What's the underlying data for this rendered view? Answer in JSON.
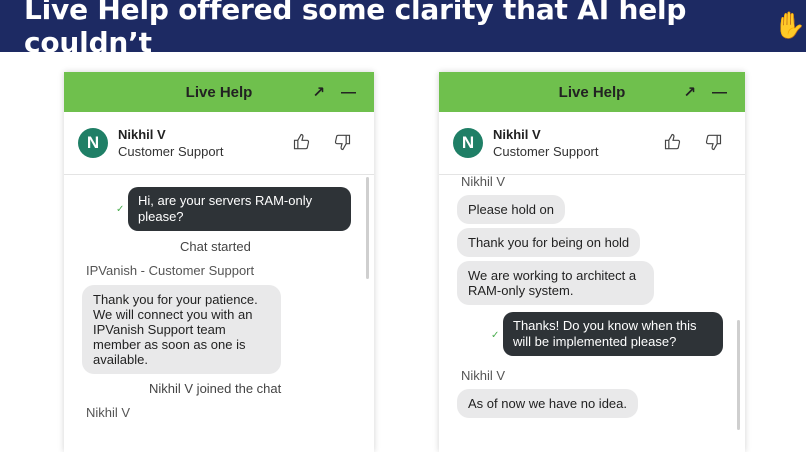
{
  "banner": {
    "title": "Live Help offered some clarity that AI help couldn’t",
    "emoji": "✋"
  },
  "left_panel": {
    "header_title": "Live Help",
    "agent_initial": "N",
    "agent_name": "Nikhil V",
    "agent_role": "Customer Support",
    "messages": {
      "user_msg": "Hi, are your servers RAM-only please?",
      "chat_started": "Chat started",
      "sender_ipvanish": "IPVanish - Customer Support",
      "ipvanish_msg": "Thank you for your patience. We will connect you with an IPVanish Support team member as soon as one is available.",
      "joined": "Nikhil V joined the chat",
      "sender_nikhil": "Nikhil V"
    }
  },
  "right_panel": {
    "header_title": "Live Help",
    "agent_initial": "N",
    "agent_name": "Nikhil V",
    "agent_role": "Customer Support",
    "messages": {
      "sender_top": "Nikhil V",
      "hold": "Please hold on",
      "thanks_hold": "Thank you for being on hold",
      "architect": "We are working to architect a RAM-only system.",
      "user_msg": "Thanks! Do you know when this will be implemented please?",
      "sender_bottom": "Nikhil V",
      "no_idea": "As of now we have no idea."
    }
  },
  "icons": {
    "expand": "expand-arrow-icon",
    "minimize": "minimize-icon",
    "thumbs_up": "thumbs-up-icon",
    "thumbs_down": "thumbs-down-icon",
    "delivered": "checkmark-icon"
  },
  "colors": {
    "banner_bg": "#1d2a63",
    "header_green": "#6fc04d",
    "avatar_bg": "#1f7f66",
    "user_bubble": "#2e3337",
    "agent_bubble": "#e9e9ea"
  }
}
